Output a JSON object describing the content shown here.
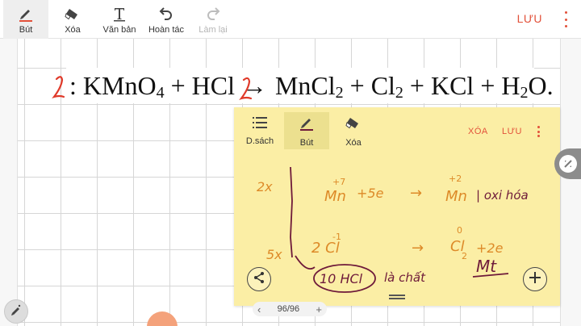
{
  "toolbar": {
    "pen_label": "Bút",
    "eraser_label": "Xóa",
    "text_label": "Văn bản",
    "undo_label": "Hoàn tác",
    "redo_label": "Làm lại",
    "save_label": "LƯU"
  },
  "equation": {
    "prefix": "2",
    "parts": [
      ": KMnO",
      "4",
      " + HCl → ",
      "2",
      "MnCl",
      "2",
      " + Cl",
      "2",
      " + KCl + H",
      "2",
      "O."
    ]
  },
  "note": {
    "list_label": "D.sách",
    "pen_label": "Bút",
    "eraser_label": "Xóa",
    "delete_label": "XÓA",
    "save_label": "LƯU",
    "handwriting": {
      "row1_coef": "2x",
      "row1_left": "Mn",
      "row1_left_sup": "+7",
      "row1_middle": "+5e",
      "row1_arrow": "→",
      "row1_right": "Mn",
      "row1_right_sup": "+2",
      "row1_note": "| oxi hóa",
      "row2_coef": "5x",
      "row2_left": "2 Cl",
      "row2_left_sup": "-1",
      "row2_arrow": "→",
      "row2_right": "Cl",
      "row2_right_sub": "2",
      "row2_right_sup": "0",
      "row2_tail": "+2e",
      "row3_circled": "10 HCl",
      "row3_text": "là chất",
      "row3_word": "Mt"
    }
  },
  "pager": {
    "page": "96/96",
    "prev": "‹",
    "next": "+"
  },
  "colors": {
    "accent": "#e2513a",
    "note_bg": "#fbeea5",
    "ink_orange": "#dd8a28",
    "ink_maroon": "#6e1a3a",
    "ink_red": "#e03a2a"
  },
  "icons": {
    "pen": "pen-icon",
    "eraser": "eraser-icon",
    "text": "text-icon",
    "undo": "undo-icon",
    "redo": "redo-icon",
    "list": "list-icon",
    "share": "share-icon",
    "add": "add-icon",
    "scroll": "scroll-handle-icon"
  }
}
